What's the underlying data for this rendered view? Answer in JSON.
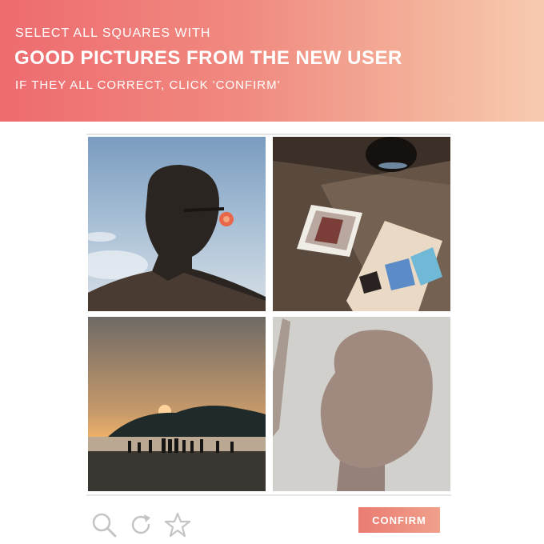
{
  "header": {
    "instruction": "SELECT ALL SQUARES WITH",
    "title": "GOOD PICTURES FROM THE NEW USER",
    "subtitle": "IF THEY ALL CORRECT, CLICK 'CONFIRM'"
  },
  "tiles": [
    {
      "subject": "silhouette-portrait-sunglasses"
    },
    {
      "subject": "desk-with-photo-frame-and-cigarettes"
    },
    {
      "subject": "sunset-beach-silhouettes"
    },
    {
      "subject": "shadow-of-person-on-wall"
    }
  ],
  "toolbar": {
    "icons": [
      "search-icon",
      "refresh-icon",
      "star-icon"
    ],
    "confirm_label": "CONFIRM"
  },
  "colors": {
    "header_gradient_start": "#ee6b6f",
    "header_gradient_end": "#f7cbb0",
    "button": "#ee8a7c",
    "icon": "#c4c4c4"
  }
}
